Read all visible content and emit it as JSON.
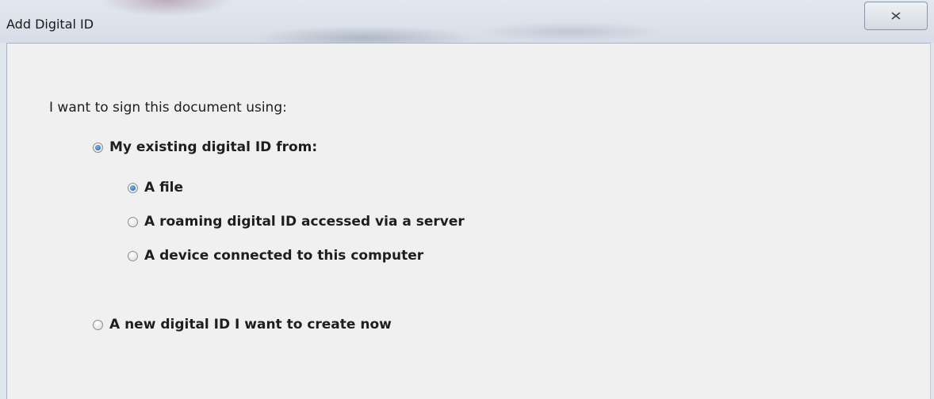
{
  "window": {
    "title": "Add Digital ID",
    "close_icon": "close-icon"
  },
  "form": {
    "prompt": "I want to sign this document using:",
    "options": [
      {
        "label": "My existing digital ID from:",
        "checked": true
      },
      {
        "label": "A file",
        "checked": true
      },
      {
        "label": "A roaming digital ID accessed via a server",
        "checked": false
      },
      {
        "label": "A device connected to this computer",
        "checked": false
      },
      {
        "label": "A new digital ID I want to create now",
        "checked": false
      }
    ]
  },
  "colors": {
    "radio_selected": "#1f5fa8",
    "dialog_background": "#f0f0f0"
  }
}
